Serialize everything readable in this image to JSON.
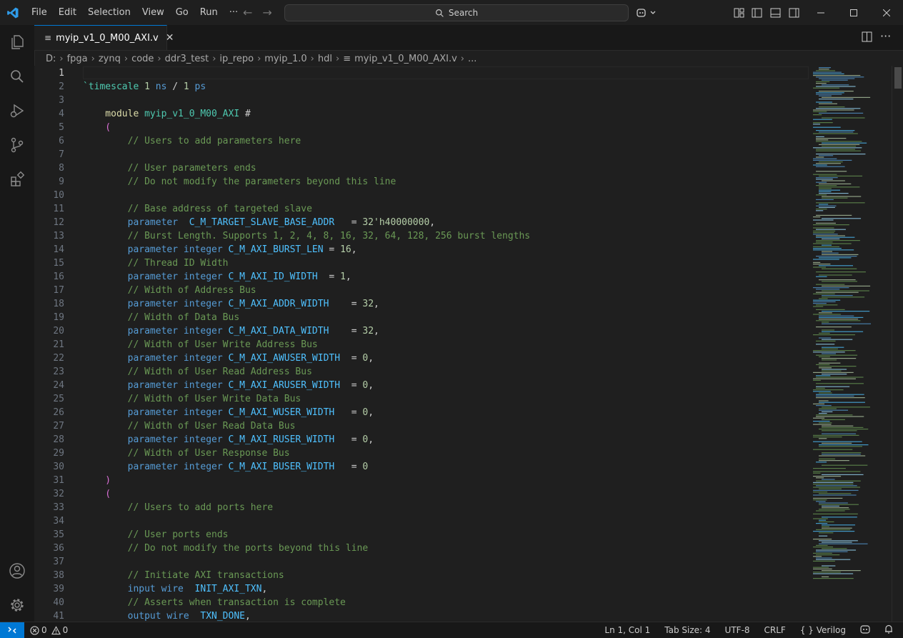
{
  "menu": [
    "File",
    "Edit",
    "Selection",
    "View",
    "Go",
    "Run",
    "···"
  ],
  "search": {
    "label": "Search"
  },
  "tab": {
    "label": "myip_v1_0_M00_AXI.v",
    "close": "✕"
  },
  "breadcrumb": [
    "D:",
    "fpga",
    "zynq",
    "code",
    "ddr3_test",
    "ip_repo",
    "myip_1.0",
    "hdl",
    "myip_v1_0_M00_AXI.v",
    "..."
  ],
  "code_lines": [
    {
      "n": "1",
      "t": []
    },
    {
      "n": "2",
      "t": [
        [
          "`timescale ",
          "#4ec9b0"
        ],
        [
          "1 ",
          "#b5cea8"
        ],
        [
          "ns",
          "#569cd6"
        ],
        [
          " / ",
          "#cccccc"
        ],
        [
          "1 ",
          "#b5cea8"
        ],
        [
          "ps",
          "#569cd6"
        ]
      ]
    },
    {
      "n": "3",
      "t": []
    },
    {
      "n": "4",
      "t": [
        [
          "    module ",
          "#dcdcaa"
        ],
        [
          "myip_v1_0_M00_AXI",
          "#4ec9b0"
        ],
        [
          " #",
          "#cccccc"
        ]
      ]
    },
    {
      "n": "5",
      "t": [
        [
          "    (",
          "#da70d6"
        ]
      ]
    },
    {
      "n": "6",
      "t": [
        [
          "        // Users to add parameters here",
          "#6a9955"
        ]
      ]
    },
    {
      "n": "7",
      "t": []
    },
    {
      "n": "8",
      "t": [
        [
          "        // User parameters ends",
          "#6a9955"
        ]
      ]
    },
    {
      "n": "9",
      "t": [
        [
          "        // Do not modify the parameters beyond this line",
          "#6a9955"
        ]
      ]
    },
    {
      "n": "10",
      "t": []
    },
    {
      "n": "11",
      "t": [
        [
          "        // Base address of targeted slave",
          "#6a9955"
        ]
      ]
    },
    {
      "n": "12",
      "t": [
        [
          "        parameter",
          "#569cd6"
        ],
        [
          "  C_M_TARGET_SLAVE_BASE_ADDR",
          "#4fc1ff"
        ],
        [
          "   = ",
          "#cccccc"
        ],
        [
          "32'h40000000",
          "#b5cea8"
        ],
        [
          ",",
          "#cccccc"
        ]
      ]
    },
    {
      "n": "13",
      "t": [
        [
          "        // Burst Length. Supports 1, 2, 4, 8, 16, 32, 64, 128, 256 burst lengths",
          "#6a9955"
        ]
      ]
    },
    {
      "n": "14",
      "t": [
        [
          "        parameter ",
          "#569cd6"
        ],
        [
          "integer ",
          "#569cd6"
        ],
        [
          "C_M_AXI_BURST_LEN",
          "#4fc1ff"
        ],
        [
          " = ",
          "#cccccc"
        ],
        [
          "16",
          "#b5cea8"
        ],
        [
          ",",
          "#cccccc"
        ]
      ]
    },
    {
      "n": "15",
      "t": [
        [
          "        // Thread ID Width",
          "#6a9955"
        ]
      ]
    },
    {
      "n": "16",
      "t": [
        [
          "        parameter ",
          "#569cd6"
        ],
        [
          "integer ",
          "#569cd6"
        ],
        [
          "C_M_AXI_ID_WIDTH",
          "#4fc1ff"
        ],
        [
          "  = ",
          "#cccccc"
        ],
        [
          "1",
          "#b5cea8"
        ],
        [
          ",",
          "#cccccc"
        ]
      ]
    },
    {
      "n": "17",
      "t": [
        [
          "        // Width of Address Bus",
          "#6a9955"
        ]
      ]
    },
    {
      "n": "18",
      "t": [
        [
          "        parameter ",
          "#569cd6"
        ],
        [
          "integer ",
          "#569cd6"
        ],
        [
          "C_M_AXI_ADDR_WIDTH",
          "#4fc1ff"
        ],
        [
          "    = ",
          "#cccccc"
        ],
        [
          "32",
          "#b5cea8"
        ],
        [
          ",",
          "#cccccc"
        ]
      ]
    },
    {
      "n": "19",
      "t": [
        [
          "        // Width of Data Bus",
          "#6a9955"
        ]
      ]
    },
    {
      "n": "20",
      "t": [
        [
          "        parameter ",
          "#569cd6"
        ],
        [
          "integer ",
          "#569cd6"
        ],
        [
          "C_M_AXI_DATA_WIDTH",
          "#4fc1ff"
        ],
        [
          "    = ",
          "#cccccc"
        ],
        [
          "32",
          "#b5cea8"
        ],
        [
          ",",
          "#cccccc"
        ]
      ]
    },
    {
      "n": "21",
      "t": [
        [
          "        // Width of User Write Address Bus",
          "#6a9955"
        ]
      ]
    },
    {
      "n": "22",
      "t": [
        [
          "        parameter ",
          "#569cd6"
        ],
        [
          "integer ",
          "#569cd6"
        ],
        [
          "C_M_AXI_AWUSER_WIDTH",
          "#4fc1ff"
        ],
        [
          "  = ",
          "#cccccc"
        ],
        [
          "0",
          "#b5cea8"
        ],
        [
          ",",
          "#cccccc"
        ]
      ]
    },
    {
      "n": "23",
      "t": [
        [
          "        // Width of User Read Address Bus",
          "#6a9955"
        ]
      ]
    },
    {
      "n": "24",
      "t": [
        [
          "        parameter ",
          "#569cd6"
        ],
        [
          "integer ",
          "#569cd6"
        ],
        [
          "C_M_AXI_ARUSER_WIDTH",
          "#4fc1ff"
        ],
        [
          "  = ",
          "#cccccc"
        ],
        [
          "0",
          "#b5cea8"
        ],
        [
          ",",
          "#cccccc"
        ]
      ]
    },
    {
      "n": "25",
      "t": [
        [
          "        // Width of User Write Data Bus",
          "#6a9955"
        ]
      ]
    },
    {
      "n": "26",
      "t": [
        [
          "        parameter ",
          "#569cd6"
        ],
        [
          "integer ",
          "#569cd6"
        ],
        [
          "C_M_AXI_WUSER_WIDTH",
          "#4fc1ff"
        ],
        [
          "   = ",
          "#cccccc"
        ],
        [
          "0",
          "#b5cea8"
        ],
        [
          ",",
          "#cccccc"
        ]
      ]
    },
    {
      "n": "27",
      "t": [
        [
          "        // Width of User Read Data Bus",
          "#6a9955"
        ]
      ]
    },
    {
      "n": "28",
      "t": [
        [
          "        parameter ",
          "#569cd6"
        ],
        [
          "integer ",
          "#569cd6"
        ],
        [
          "C_M_AXI_RUSER_WIDTH",
          "#4fc1ff"
        ],
        [
          "   = ",
          "#cccccc"
        ],
        [
          "0",
          "#b5cea8"
        ],
        [
          ",",
          "#cccccc"
        ]
      ]
    },
    {
      "n": "29",
      "t": [
        [
          "        // Width of User Response Bus",
          "#6a9955"
        ]
      ]
    },
    {
      "n": "30",
      "t": [
        [
          "        parameter ",
          "#569cd6"
        ],
        [
          "integer ",
          "#569cd6"
        ],
        [
          "C_M_AXI_BUSER_WIDTH",
          "#4fc1ff"
        ],
        [
          "   = ",
          "#cccccc"
        ],
        [
          "0",
          "#b5cea8"
        ]
      ]
    },
    {
      "n": "31",
      "t": [
        [
          "    )",
          "#da70d6"
        ]
      ]
    },
    {
      "n": "32",
      "t": [
        [
          "    (",
          "#da70d6"
        ]
      ]
    },
    {
      "n": "33",
      "t": [
        [
          "        // Users to add ports here",
          "#6a9955"
        ]
      ]
    },
    {
      "n": "34",
      "t": []
    },
    {
      "n": "35",
      "t": [
        [
          "        // User ports ends",
          "#6a9955"
        ]
      ]
    },
    {
      "n": "36",
      "t": [
        [
          "        // Do not modify the ports beyond this line",
          "#6a9955"
        ]
      ]
    },
    {
      "n": "37",
      "t": []
    },
    {
      "n": "38",
      "t": [
        [
          "        // Initiate AXI transactions",
          "#6a9955"
        ]
      ]
    },
    {
      "n": "39",
      "t": [
        [
          "        input ",
          "#569cd6"
        ],
        [
          "wire",
          "#569cd6"
        ],
        [
          "  INIT_AXI_TXN",
          "#4fc1ff"
        ],
        [
          ",",
          "#cccccc"
        ]
      ]
    },
    {
      "n": "40",
      "t": [
        [
          "        // Asserts when transaction is complete",
          "#6a9955"
        ]
      ]
    },
    {
      "n": "41",
      "t": [
        [
          "        output ",
          "#569cd6"
        ],
        [
          "wire",
          "#569cd6"
        ],
        [
          "  TXN_DONE",
          "#4fc1ff"
        ],
        [
          ",",
          "#cccccc"
        ]
      ]
    }
  ],
  "status": {
    "errors": "0",
    "warnings": "0",
    "position": "Ln 1, Col 1",
    "tab_size": "Tab Size: 4",
    "encoding": "UTF-8",
    "eol": "CRLF",
    "language": "Verilog",
    "language_icon": "{ }"
  },
  "colors": {
    "accent": "#0078d4",
    "background": "#1f1f1f",
    "sidebar": "#181818"
  }
}
